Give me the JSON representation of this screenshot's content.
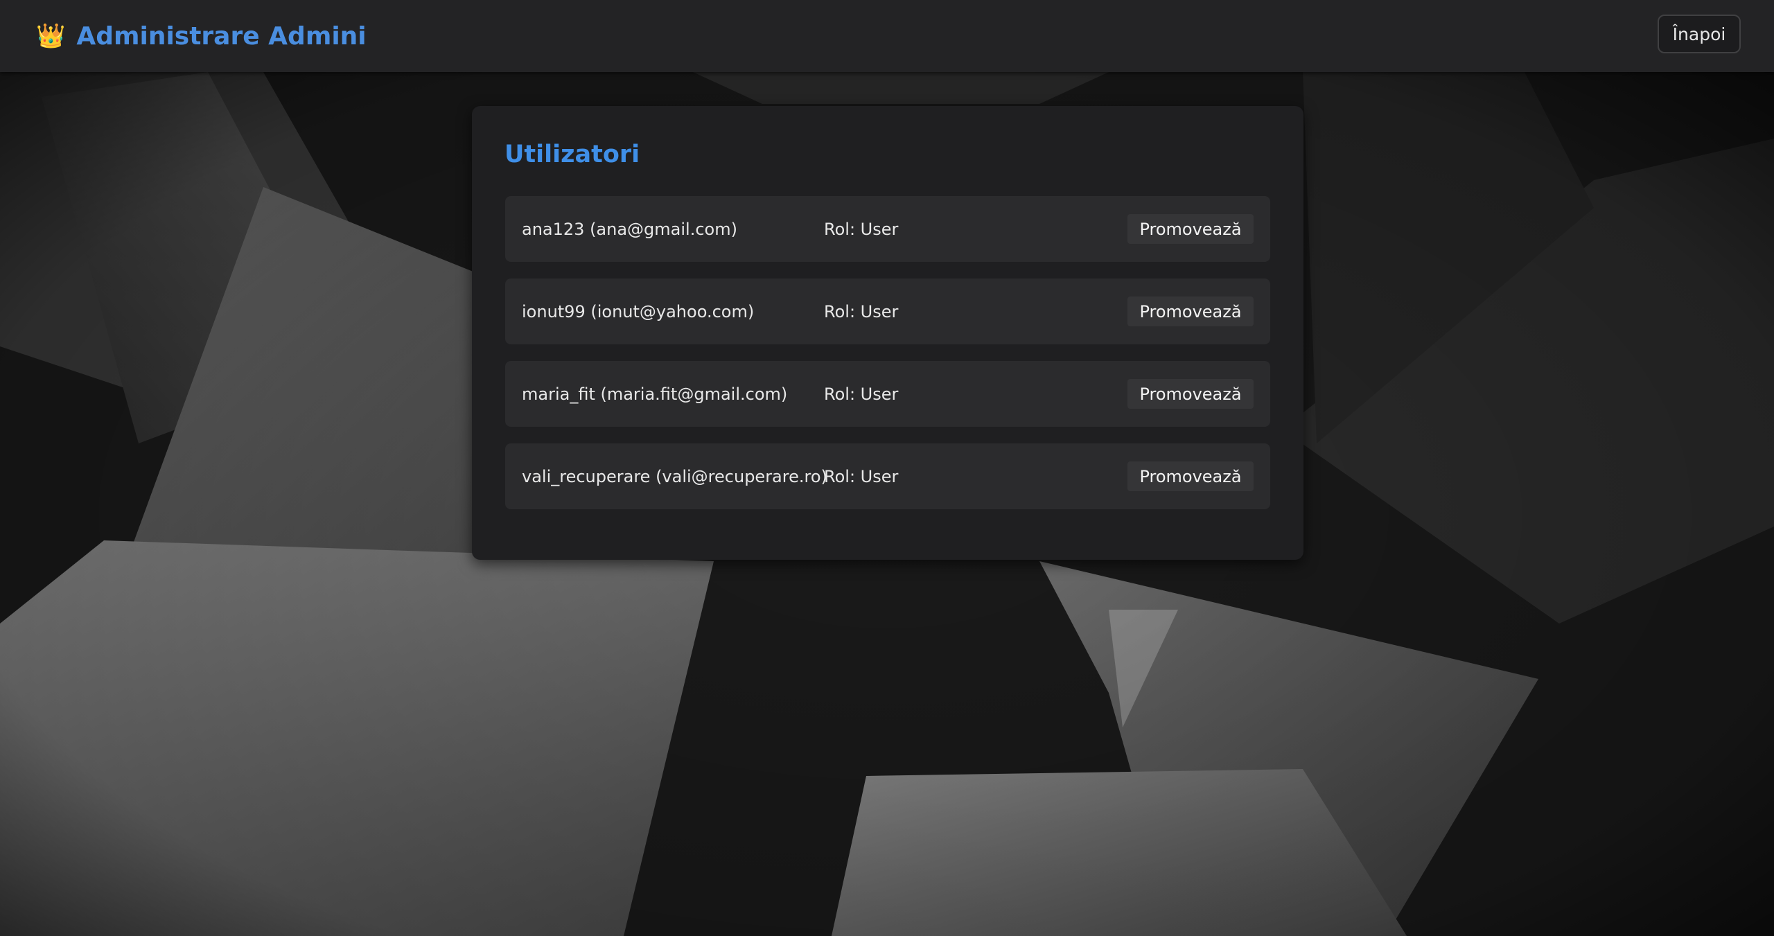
{
  "header": {
    "title": "Administrare Admini",
    "back_label": "Înapoi"
  },
  "panel": {
    "title": "Utilizatori",
    "users": [
      {
        "name": "ana123 (ana@gmail.com)",
        "role": "Rol: User",
        "action": "Promovează"
      },
      {
        "name": "ionut99 (ionut@yahoo.com)",
        "role": "Rol: User",
        "action": "Promovează"
      },
      {
        "name": "maria_fit (maria.fit@gmail.com)",
        "role": "Rol: User",
        "action": "Promovează"
      },
      {
        "name": "vali_recuperare (vali@recuperare.ro)",
        "role": "Rol: User",
        "action": "Promovează"
      }
    ]
  },
  "icons": {
    "brand": "crown-icon"
  },
  "colors": {
    "accent": "#4a8ee0",
    "header_bg": "#232325",
    "panel_bg": "#1f1f21",
    "row_bg": "#2b2b2d"
  }
}
